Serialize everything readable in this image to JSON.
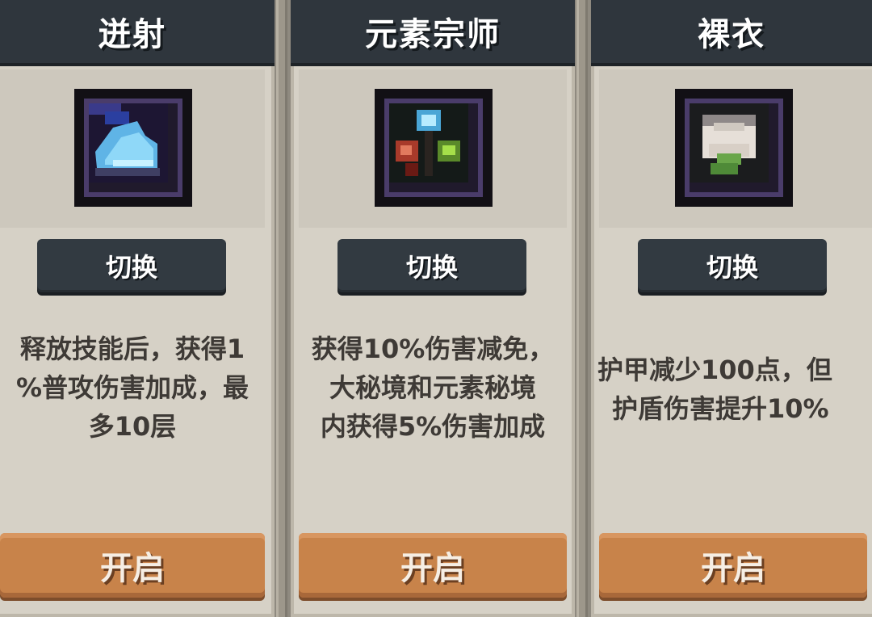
{
  "cards": [
    {
      "title": "迸射",
      "icon": "ice-shard-icon",
      "switch_label": "切换",
      "description": [
        "释放技能后，获得1",
        "%普攻伤害加成，最",
        "多10层"
      ],
      "open_label": "开启"
    },
    {
      "title": "元素宗师",
      "icon": "element-orbs-icon",
      "switch_label": "切换",
      "description": [
        "获得10%伤害减免，",
        "大秘境和元素秘境",
        "内获得5%伤害加成"
      ],
      "open_label": "开启"
    },
    {
      "title": "裸衣",
      "icon": "robe-icon",
      "switch_label": "切换",
      "description": [
        "护甲减少100点，但",
        "护盾伤害提升10%"
      ],
      "open_label": "开启"
    }
  ],
  "colors": {
    "header": "#2f363d",
    "card_bg": "#d6d1c6",
    "switch_button": "#323a41",
    "open_button": "#c8834a",
    "text": "#3e3a36"
  }
}
